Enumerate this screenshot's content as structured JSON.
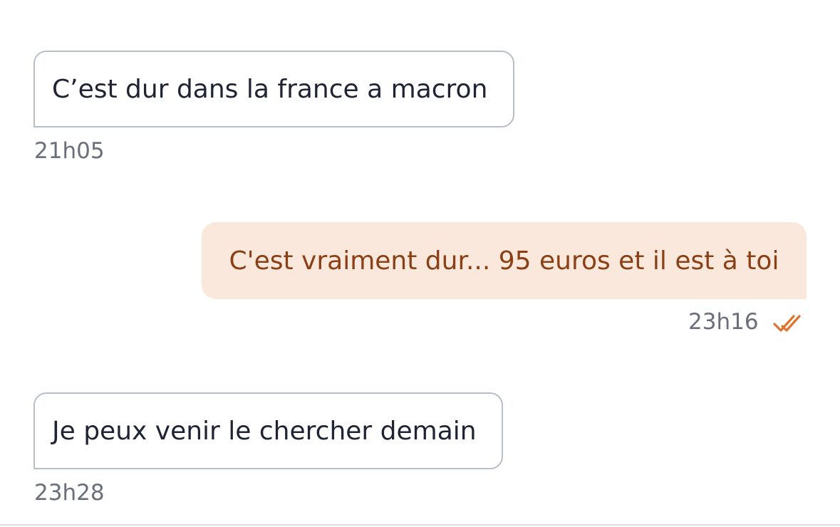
{
  "conversation": {
    "messages": [
      {
        "direction": "incoming",
        "text": "C’est dur dans la france a macron",
        "time": "21h05"
      },
      {
        "direction": "outgoing",
        "text": "C'est vraiment dur... 95  euros et il est à toi",
        "time": "23h16",
        "status_icon": "double-check-icon"
      },
      {
        "direction": "incoming",
        "text": "Je peux venir le chercher demain",
        "time": "23h28"
      }
    ]
  },
  "colors": {
    "outgoing_bubble": "#fbe8dd",
    "outgoing_text": "#8a3f14",
    "read_check": "#e0742e",
    "incoming_border": "#b9bdc8"
  }
}
